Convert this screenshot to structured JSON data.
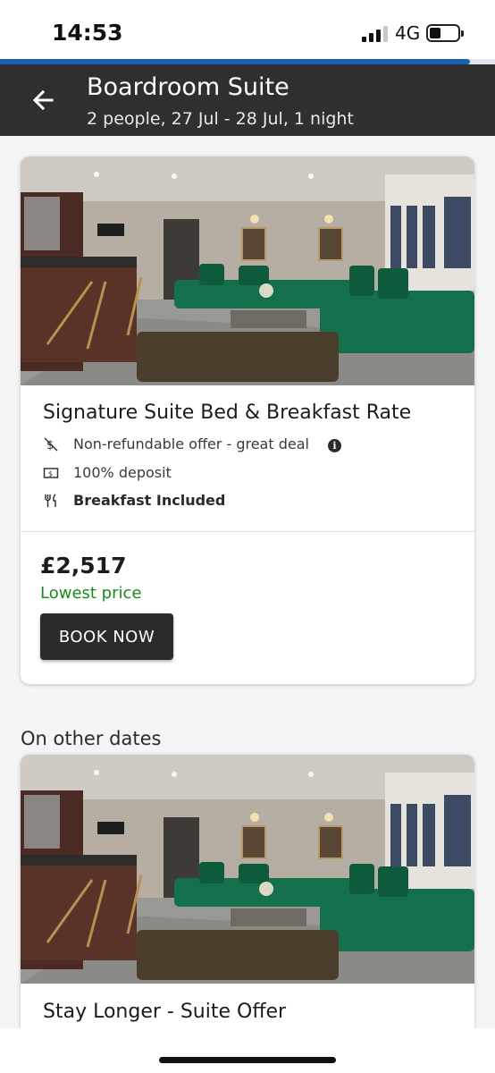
{
  "status_bar": {
    "time": "14:53",
    "network": "4G",
    "battery_level": 0.4,
    "signal_bars": 3,
    "signal_total": 4
  },
  "page_progress": 0.95,
  "header": {
    "title": "Boardroom Suite",
    "subtitle": "2 people, 27 Jul - 28 Jul, 1 night",
    "back_icon": "arrow-left-icon"
  },
  "colors": {
    "header_bg": "#2f2f2f",
    "progress": "#1a5fb4",
    "lowest_price": "#1b8a1b",
    "book_button": "#2b2b2b"
  },
  "offer": {
    "title": "Signature Suite Bed & Breakfast Rate",
    "features": [
      {
        "icon": "non-refundable-icon",
        "text": "Non-refundable offer - great deal",
        "info_icon": "info-icon"
      },
      {
        "icon": "deposit-icon",
        "text": "100% deposit"
      },
      {
        "icon": "cutlery-icon",
        "text": "Breakfast Included"
      }
    ],
    "price": "£2,517",
    "price_note": "Lowest price",
    "book_label": "BOOK NOW"
  },
  "other_dates": {
    "heading": "On other dates",
    "offers": [
      {
        "title": "Stay Longer - Suite Offer"
      }
    ]
  }
}
